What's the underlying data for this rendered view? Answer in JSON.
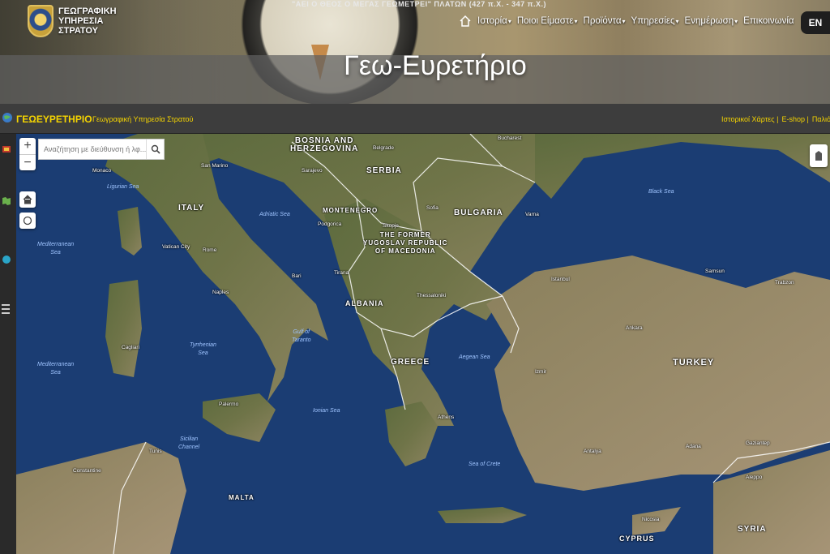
{
  "header": {
    "motto": "\"ΑΕΙ Ο ΘΕΟΣ Ο ΜΕΓΑΣ ΓΕΩΜΕΤΡΕΙ\" ΠΛΑΤΩΝ (427 π.Χ. - 347 π.Χ.)",
    "logo_lines": [
      "ΓΕΩΓΡΑΦΙΚΗ",
      "ΥΠΗΡΕΣΙΑ",
      "ΣΤΡΑΤΟΥ"
    ],
    "nav": [
      {
        "label": "Ιστορία",
        "dropdown": true
      },
      {
        "label": "Ποιοι Είμαστε",
        "dropdown": true
      },
      {
        "label": "Προϊόντα",
        "dropdown": true
      },
      {
        "label": "Υπηρεσίες",
        "dropdown": true
      },
      {
        "label": "Ενημέρωση",
        "dropdown": true
      },
      {
        "label": "Επικοινωνία",
        "dropdown": false
      }
    ],
    "lang": "EN",
    "title": "Γεω-Ευρετήριο"
  },
  "appbar": {
    "app_name": "ΓΕΩΕΥΡΕΤΗΡΙΟ",
    "org_link": "Γεωγραφική Υπηρεσία Στρατού",
    "right_links": [
      "Ιστορικοί Χάρτες |",
      "E-shop |",
      "Παλιό Γεω"
    ]
  },
  "map": {
    "search_placeholder": "Αναζήτηση με διεύθυνση ή λφ...",
    "zoom_in": "+",
    "zoom_out": "−",
    "countries": {
      "bosnia": "BOSNIA AND\nHERZEGOVINA",
      "serbia": "SERBIA",
      "italy": "ITALY",
      "montenegro": "MONTENEGRO",
      "bulgaria": "BULGARIA",
      "macedonia": "THE FORMER\nYUGOSLAV REPUBLIC\nOF MACEDONIA",
      "albania": "ALBANIA",
      "greece": "GREECE",
      "turkey": "TURKEY",
      "malta": "MALTA",
      "cyprus": "CYPRUS",
      "syria": "SYRIA"
    },
    "seas": {
      "ligurian": "Ligurian Sea",
      "mediterranean1": "Mediterranean\nSea",
      "mediterranean2": "Mediterranean\nSea",
      "adriatic": "Adriatic Sea",
      "tyrrhenian": "Tyrrhenian\nSea",
      "taranto": "Gulf of\nTaranto",
      "ionian": "Ionian Sea",
      "aegean": "Aegean Sea",
      "sicilian": "Sicilian\nChannel",
      "crete": "Sea of Crete",
      "black": "Black Sea"
    },
    "cities": {
      "monaco": "Monaco",
      "san_marino": "San Marino",
      "vatican": "Vatican City",
      "rome": "Rome",
      "naples": "Naples",
      "bari": "Bari",
      "palermo": "Palermo",
      "tunis": "Tunis",
      "sarajevo": "Sarajevo",
      "belgrade": "Belgrade",
      "bucharest": "Bucharest",
      "sofia": "Sofia",
      "skopje": "Skopje",
      "podgorica": "Podgorica",
      "tirana": "Tirana",
      "thessaloniki": "Thessaloniki",
      "istanbul": "Istanbul",
      "ankara": "Ankara",
      "izmir": "Izmir",
      "athens": "Athens",
      "antalya": "Antalya",
      "adana": "Adana",
      "nicosia": "Nicosia",
      "aleppo": "Aleppo",
      "samsun": "Samsun",
      "trabzon": "Trabzon",
      "gaziantep": "Gaziantep",
      "cagliari": "Cagliari",
      "constantine": "Constantine",
      "varna": "Varna"
    }
  }
}
